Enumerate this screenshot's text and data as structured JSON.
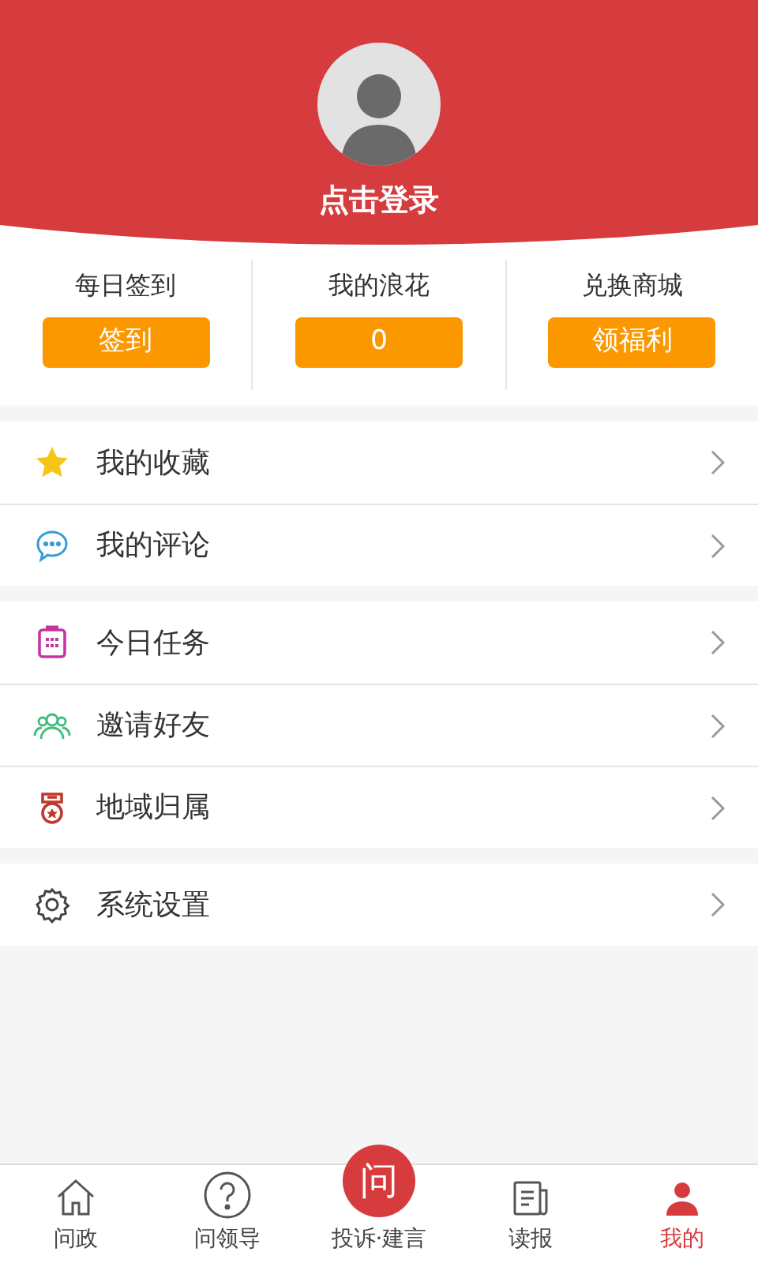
{
  "header": {
    "login_label": "点击登录"
  },
  "stats": [
    {
      "title": "每日签到",
      "button": "签到"
    },
    {
      "title": "我的浪花",
      "button": "0"
    },
    {
      "title": "兑换商城",
      "button": "领福利"
    }
  ],
  "menu_groups": [
    [
      {
        "kind": "star",
        "label": "我的收藏"
      },
      {
        "kind": "comment",
        "label": "我的评论"
      }
    ],
    [
      {
        "kind": "calendar",
        "label": "今日任务"
      },
      {
        "kind": "friends",
        "label": "邀请好友"
      },
      {
        "kind": "medal",
        "label": "地域归属"
      }
    ],
    [
      {
        "kind": "settings",
        "label": "系统设置"
      }
    ]
  ],
  "bottom_nav": [
    {
      "kind": "home",
      "label": "问政",
      "selected": false
    },
    {
      "kind": "question",
      "label": "问领导",
      "selected": false
    },
    {
      "kind": "center",
      "icon_text": "问",
      "label": "投诉·建言",
      "selected": false
    },
    {
      "kind": "news",
      "label": "读报",
      "selected": false
    },
    {
      "kind": "person",
      "label": "我的",
      "selected": true
    }
  ]
}
